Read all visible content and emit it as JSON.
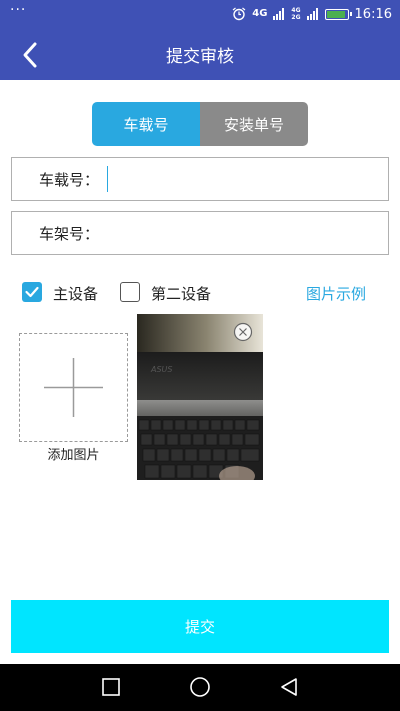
{
  "status_bar": {
    "dots": "···",
    "network": "4G",
    "network2": "4G",
    "network3": "2G",
    "time": "16:16"
  },
  "header": {
    "title": "提交审核",
    "back_icon": "chevron-left-icon"
  },
  "segment": {
    "tabs": [
      {
        "label": "车载号",
        "active": true
      },
      {
        "label": "安装单号",
        "active": false
      }
    ]
  },
  "fields": [
    {
      "label": "车载号：",
      "value": ""
    },
    {
      "label": "车架号：",
      "value": ""
    }
  ],
  "devices": {
    "primary": {
      "label": "主设备",
      "checked": true
    },
    "secondary": {
      "label": "第二设备",
      "checked": false
    },
    "example_link": "图片示例"
  },
  "photos": {
    "add_label": "添加图片",
    "remove_icon": "close-circle-icon"
  },
  "submit_label": "提交",
  "colors": {
    "primary": "#3f51b5",
    "accent": "#29a8e0",
    "submit": "#00e5ff",
    "inactive_tab": "#8a8a8a"
  }
}
